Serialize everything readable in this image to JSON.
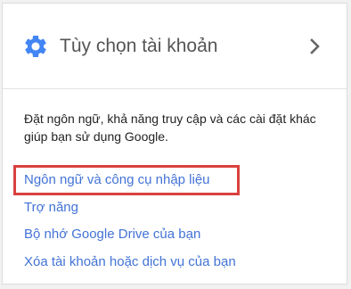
{
  "header": {
    "icon": "gear-icon",
    "title": "Tùy chọn tài khoản",
    "action_icon": "chevron-right-icon"
  },
  "description": "Đặt ngôn ngữ, khả năng truy cập và các cài đặt khác giúp bạn sử dụng Google.",
  "links": [
    {
      "label": "Ngôn ngữ và công cụ nhập liệu",
      "highlighted": true
    },
    {
      "label": "Trợ năng"
    },
    {
      "label": "Bộ nhớ Google Drive của bạn"
    },
    {
      "label": "Xóa tài khoản hoặc dịch vụ của bạn"
    }
  ],
  "colors": {
    "accent": "#4285f4",
    "link": "#4273d6",
    "highlight_border": "#d9413e",
    "title": "#555555",
    "chevron": "#666666"
  }
}
